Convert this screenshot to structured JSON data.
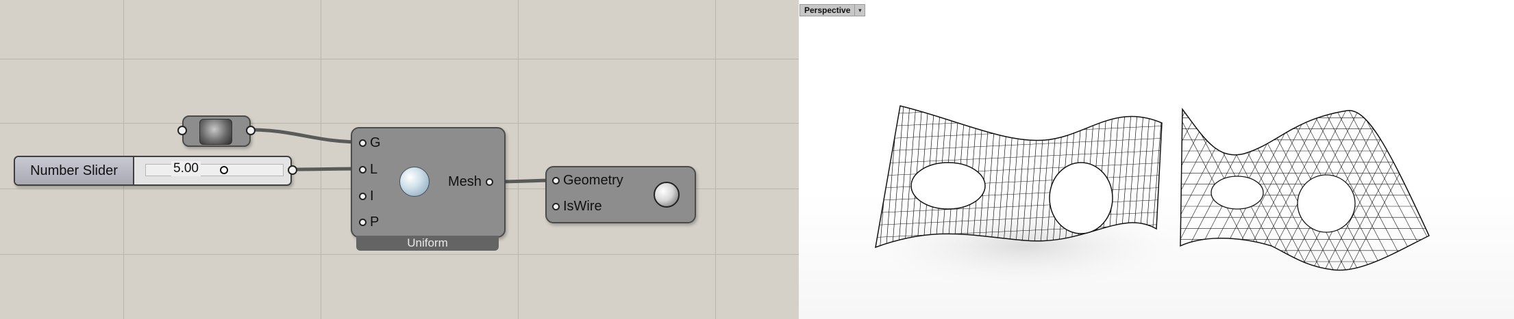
{
  "canvas": {
    "background": "#d5d1c8",
    "slider": {
      "label": "Number Slider",
      "value": "5.00"
    },
    "param_node": {
      "icon": "mesh-param-icon"
    },
    "remesh": {
      "inputs": [
        "G",
        "L",
        "I",
        "P"
      ],
      "output": "Mesh",
      "name": "Uniform",
      "icon": "remesh-sphere-icon"
    },
    "preview": {
      "inputs": [
        "Geometry",
        "IsWire"
      ],
      "icon": "sphere-preview-icon"
    }
  },
  "viewport": {
    "title": "Perspective",
    "menu_icon": "dropdown-arrow-icon",
    "objects": [
      "surface-with-holes-3d",
      "triangulated-mesh-plan"
    ]
  }
}
